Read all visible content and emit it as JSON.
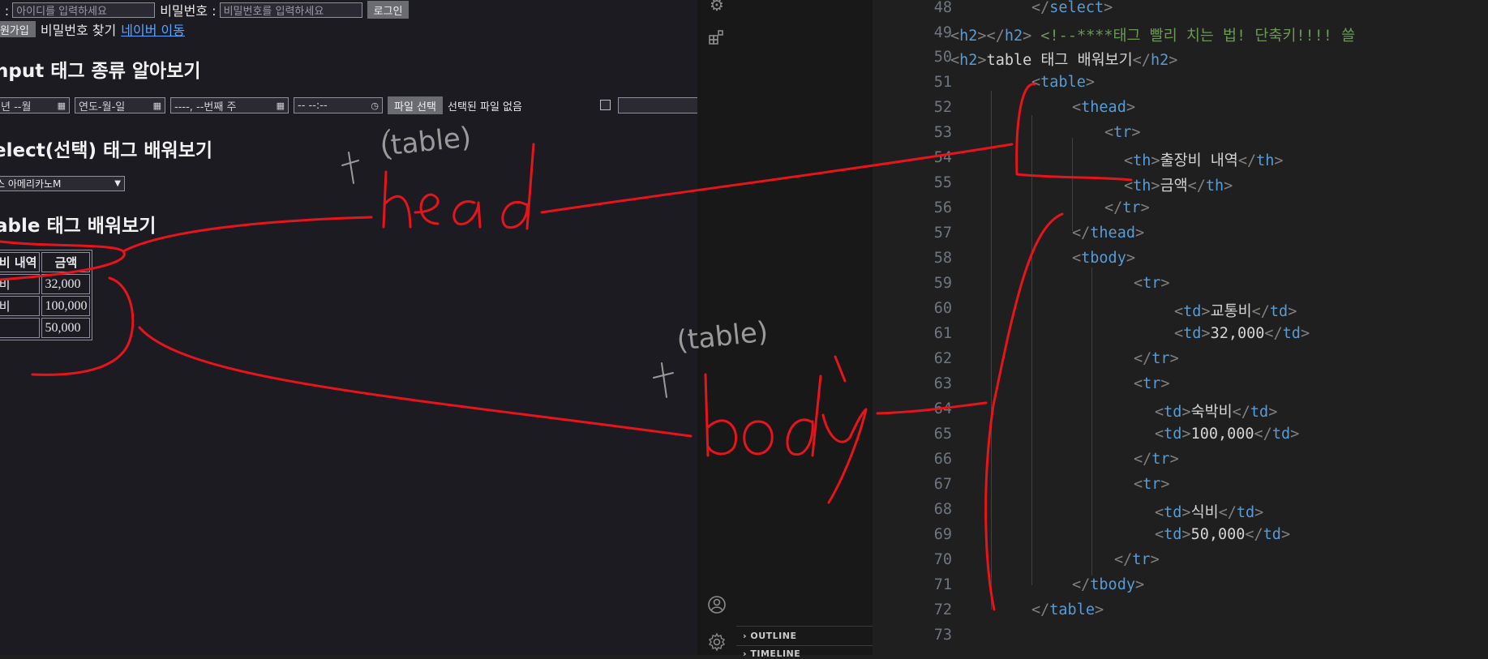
{
  "browser": {
    "login": {
      "id_label": "디 :",
      "id_placeholder": "아이디를 입력하세요",
      "pw_label": "비밀번호 :",
      "pw_placeholder": "비밀번호를 입력하세요",
      "login_button": "로그인"
    },
    "links": {
      "signup_button": "회원가입",
      "find_password": "비밀번호 찾기",
      "naver_link": "네이버 이동"
    },
    "headings": {
      "input_types": "nput 태그 종류 알아보기",
      "select_tag": "elect(선택) 태그 배워보기",
      "table_tag": "able 태그 배워보기"
    },
    "inputs": {
      "month": "년 --월",
      "date": "연도-월-일",
      "week": "----, --번째 주",
      "time": "-- --:--",
      "file_button": "파일 선택",
      "file_status": "선택된 파일 없음"
    },
    "select": {
      "value": "스 아메리카노M"
    },
    "table": {
      "headers": [
        "장비 내역",
        "금액"
      ],
      "rows": [
        [
          "통비",
          "32,000"
        ],
        [
          "박비",
          "100,000"
        ],
        [
          "비",
          "50,000"
        ]
      ]
    }
  },
  "editor": {
    "activity_icons": [
      "run-debug-icon",
      "extensions-icon",
      "account-icon",
      "settings-gear-icon"
    ],
    "panels": [
      "OUTLINE",
      "TIMELINE"
    ],
    "line_numbers": [
      "48",
      "49",
      "50",
      "51",
      "52",
      "53",
      "54",
      "55",
      "56",
      "57",
      "58",
      "59",
      "60",
      "61",
      "62",
      "63",
      "64",
      "65",
      "66",
      "67",
      "68",
      "69",
      "70",
      "71",
      "72",
      "73"
    ],
    "code": {
      "l48": [
        "</",
        "select",
        ">"
      ],
      "l49": [
        "<",
        "h2",
        "></",
        "h2",
        ">",
        " <!--****태그 빨리 치는 법! 단축키!!!! 쓸 "
      ],
      "l50": [
        "<",
        "h2",
        ">",
        "table 태그 배워보기",
        "</",
        "h2",
        ">"
      ],
      "l51": [
        "<",
        "table",
        ">"
      ],
      "l52": [
        "<",
        "thead",
        ">"
      ],
      "l53": [
        "<",
        "tr",
        ">"
      ],
      "l54": [
        "<",
        "th",
        ">",
        "출장비 내역",
        "</",
        "th",
        ">"
      ],
      "l55": [
        "<",
        "th",
        ">",
        "금액",
        "</",
        "th",
        ">"
      ],
      "l56": [
        "</",
        "tr",
        ">"
      ],
      "l57": [
        "</",
        "thead",
        ">"
      ],
      "l58": [
        "<",
        "tbody",
        ">"
      ],
      "l59": [
        "<",
        "tr",
        ">"
      ],
      "l60": [
        "<",
        "td",
        ">",
        "교통비",
        "</",
        "td",
        ">"
      ],
      "l61": [
        "<",
        "td",
        ">",
        "32,000",
        "</",
        "td",
        ">"
      ],
      "l62": [
        "</",
        "tr",
        ">"
      ],
      "l63": [
        "<",
        "tr",
        ">"
      ],
      "l64": [
        "<",
        "td",
        ">",
        "숙박비",
        "</",
        "td",
        ">"
      ],
      "l65": [
        "<",
        "td",
        ">",
        "100,000",
        "</",
        "td",
        ">"
      ],
      "l66": [
        "</",
        "tr",
        ">"
      ],
      "l67": [
        "<",
        "tr",
        ">"
      ],
      "l68": [
        "<",
        "td",
        ">",
        "식비",
        "</",
        "td",
        ">"
      ],
      "l69": [
        "<",
        "td",
        ">",
        "50,000",
        "</",
        "td",
        ">"
      ],
      "l70": [
        "</",
        "tr",
        ">"
      ],
      "l71": [
        "</",
        "tbody",
        ">"
      ],
      "l72": [
        "</",
        "table",
        ">"
      ]
    }
  },
  "annotations": {
    "head_word": "head",
    "body_word": "body",
    "t_letter": "t",
    "table_note": "(table)",
    "ink_color": "#e8141b",
    "pencil_color": "#9a9a9a"
  },
  "colors": {
    "browser_bg": "#1c1b22",
    "editor_bg": "#1f1f1f",
    "tag": "#569cd6",
    "comment": "#6a9955",
    "link": "#5aa5ff"
  }
}
